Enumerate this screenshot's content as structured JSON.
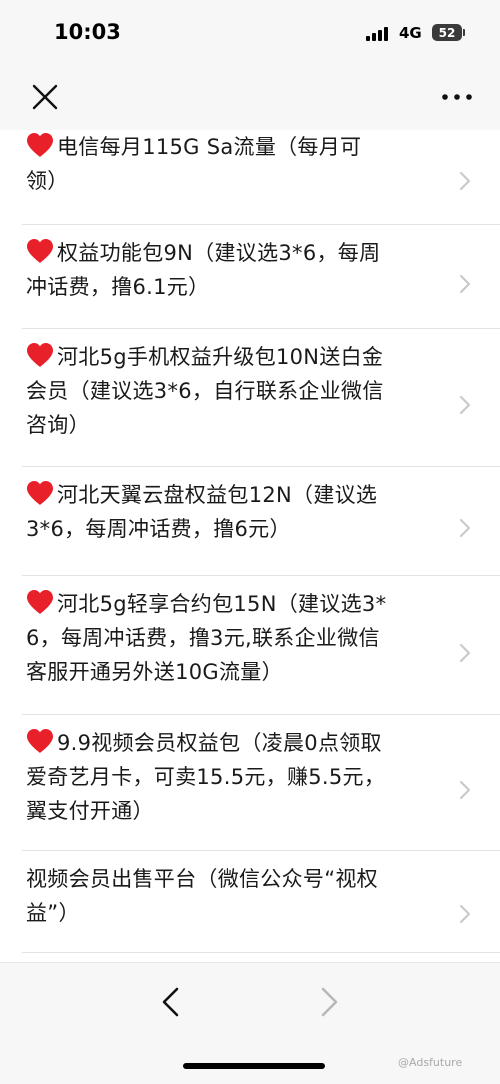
{
  "status_bar": {
    "time": "10:03",
    "network": "4G",
    "battery": "52"
  },
  "nav": {
    "close_icon": "close-icon",
    "more_icon": "more-icon"
  },
  "list": {
    "items": [
      {
        "heart": true,
        "lines": [
          "电信每月115G Sa流量（每月可",
          "领）"
        ]
      },
      {
        "heart": true,
        "lines": [
          "权益功能包9N（建议选3*6，每周",
          "冲话费，撸6.1元）"
        ]
      },
      {
        "heart": true,
        "lines": [
          "河北5g手机权益升级包10N送白金",
          "会员（建议选3*6，自行联系企业微信",
          "咨询）"
        ]
      },
      {
        "heart": true,
        "lines": [
          "河北天翼云盘权益包12N（建议选",
          "3*6，每周冲话费，撸6元）"
        ]
      },
      {
        "heart": true,
        "lines": [
          "河北5g轻享合约包15N（建议选3*",
          "6，每周冲话费，撸3元,联系企业微信",
          "客服开通另外送10G流量）"
        ]
      },
      {
        "heart": true,
        "lines": [
          "9.9视频会员权益包（凌晨0点领取",
          "爱奇艺月卡，可卖15.5元，赚5.5元，",
          "翼支付开通）"
        ]
      },
      {
        "heart": false,
        "lines": [
          "视频会员出售平台（微信公众号“视权",
          "益”）"
        ]
      }
    ]
  },
  "bottom": {
    "back_icon": "chevron-left-icon",
    "forward_icon": "chevron-right-icon"
  },
  "watermark": "@Adsfuture",
  "colors": {
    "heart": "#e8202a",
    "chevron": "#c7c7cc",
    "divider": "#e3e3e3",
    "bar_bg": "#f7f7f7"
  }
}
